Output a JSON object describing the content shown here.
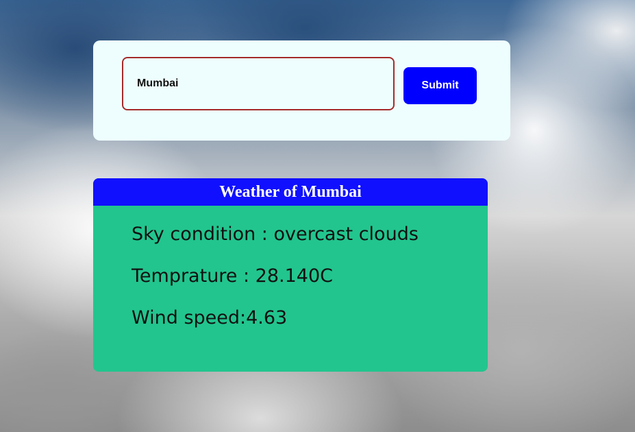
{
  "search": {
    "value": "Mumbai",
    "submit_label": "Submit"
  },
  "weather": {
    "title": "Weather of Mumbai",
    "sky_condition": "Sky condition : overcast clouds",
    "temperature": "Temprature : 28.140C",
    "wind_speed": "Wind speed:4.63"
  },
  "colors": {
    "submit_button": "#0000ff",
    "title_bar": "#1010ff",
    "weather_card": "#22c58e",
    "input_border": "#a52a2a",
    "search_card": "#eefefe"
  }
}
